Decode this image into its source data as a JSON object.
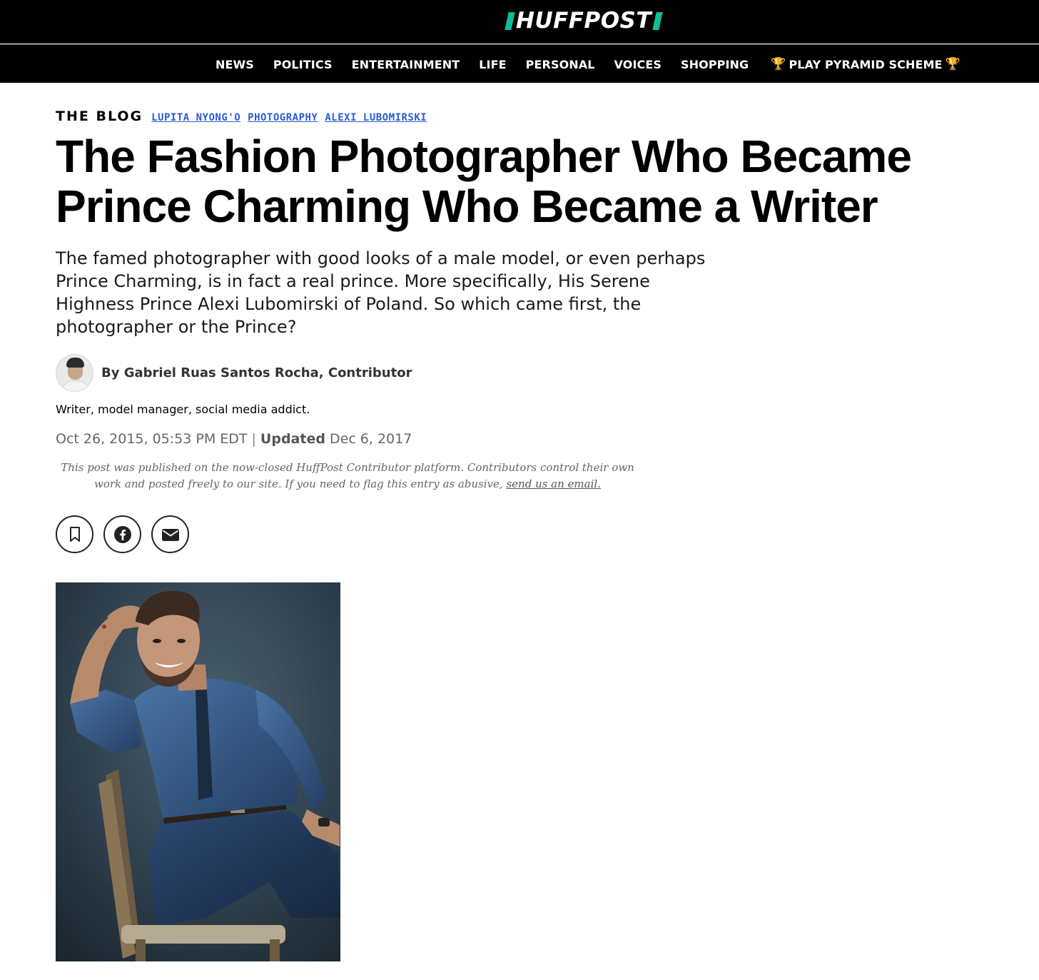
{
  "header": {
    "logo_text": "HUFFPOST",
    "logo_accent_color": "#0dbe98",
    "nav": [
      {
        "label": "NEWS"
      },
      {
        "label": "POLITICS"
      },
      {
        "label": "ENTERTAINMENT"
      },
      {
        "label": "LIFE"
      },
      {
        "label": "PERSONAL"
      },
      {
        "label": "VOICES"
      },
      {
        "label": "SHOPPING"
      },
      {
        "label": "PLAY PYRAMID SCHEME",
        "icon": "trophy-icon"
      }
    ]
  },
  "article": {
    "section": "THE BLOG",
    "tags": [
      "LUPITA NYONG'O",
      "PHOTOGRAPHY",
      "ALEXI LUBOMIRSKI"
    ],
    "tag_color": "#2a5bd7",
    "title": "The Fashion Photographer Who Became Prince Charming Who Became a Writer",
    "dek": "The famed photographer with good looks of a male model, or even perhaps Prince Charming, is in fact a real prince. More specifically, His Serene Highness Prince Alexi Lubomirski of Poland. So which came first, the photographer or the Prince?",
    "byline": "By Gabriel Ruas Santos Rocha, Contributor",
    "bio": "Writer, model manager, social media addict.",
    "published": "Oct 26, 2015, 05:53 PM EDT",
    "separator": "|",
    "updated_label": "Updated",
    "updated": "Dec 6, 2017",
    "disclaimer_text": "This post was published on the now-closed HuffPost Contributor platform. Contributors control their own work and posted freely to our site. If you need to flag this entry as abusive,",
    "disclaimer_link": "send us an email.",
    "share_buttons": [
      {
        "icon": "bookmark-icon"
      },
      {
        "icon": "facebook-icon"
      },
      {
        "icon": "email-icon"
      }
    ]
  }
}
